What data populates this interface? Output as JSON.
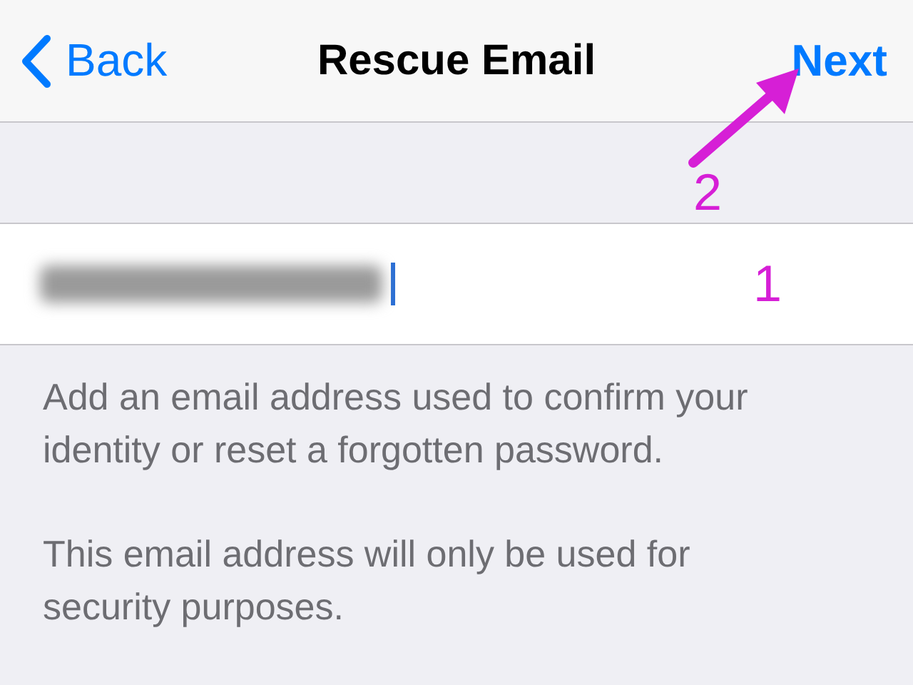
{
  "nav_bar": {
    "back": "Back",
    "title": "Rescue Email",
    "next": "Next"
  },
  "email_field": {
    "blurred": true
  },
  "annotations": [
    {
      "text": "2"
    },
    {
      "text": "1"
    }
  ],
  "footer": [
    "Add an email address used to confirm your identity or reset a forgotten password.",
    "This email address will only be used for security purposes."
  ]
}
